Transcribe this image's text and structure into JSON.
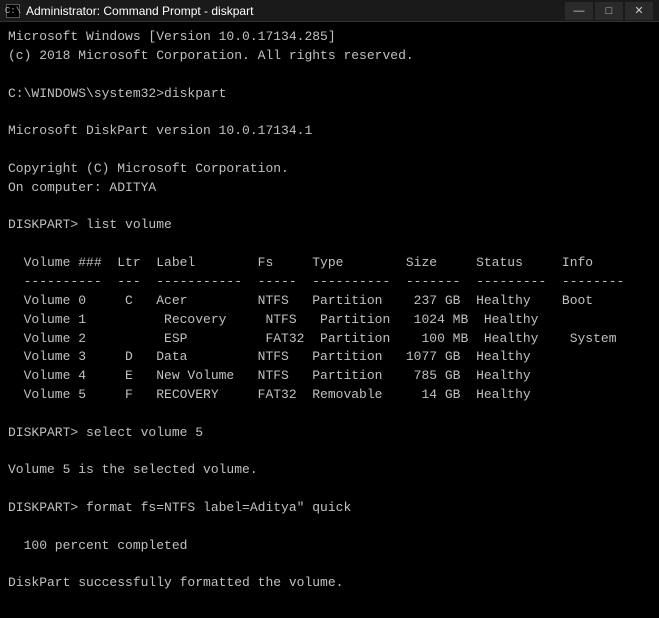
{
  "titlebar": {
    "icon": "C:\\",
    "title": "Administrator: Command Prompt - diskpart",
    "minimize": "—",
    "maximize": "□",
    "close": "✕"
  },
  "console": {
    "lines": [
      "Microsoft Windows [Version 10.0.17134.285]",
      "(c) 2018 Microsoft Corporation. All rights reserved.",
      "",
      "C:\\WINDOWS\\system32>diskpart",
      "",
      "Microsoft DiskPart version 10.0.17134.1",
      "",
      "Copyright (C) Microsoft Corporation.",
      "On computer: ADITYA",
      "",
      "DISKPART> list volume",
      "",
      "  Volume ###  Ltr  Label        Fs     Type        Size     Status     Info",
      "  ----------  ---  -----------  -----  ----------  -------  ---------  --------",
      "  Volume 0     C   Acer         NTFS   Partition    237 GB  Healthy    Boot",
      "  Volume 1          Recovery     NTFS   Partition   1024 MB  Healthy",
      "  Volume 2          ESP          FAT32  Partition    100 MB  Healthy    System",
      "  Volume 3     D   Data         NTFS   Partition   1077 GB  Healthy",
      "  Volume 4     E   New Volume   NTFS   Partition    785 GB  Healthy",
      "  Volume 5     F   RECOVERY     FAT32  Removable     14 GB  Healthy",
      "",
      "DISKPART> select volume 5",
      "",
      "Volume 5 is the selected volume.",
      "",
      "DISKPART> format fs=NTFS label=Aditya\" quick",
      "",
      "  100 percent completed",
      "",
      "DiskPart successfully formatted the volume.",
      ""
    ]
  }
}
